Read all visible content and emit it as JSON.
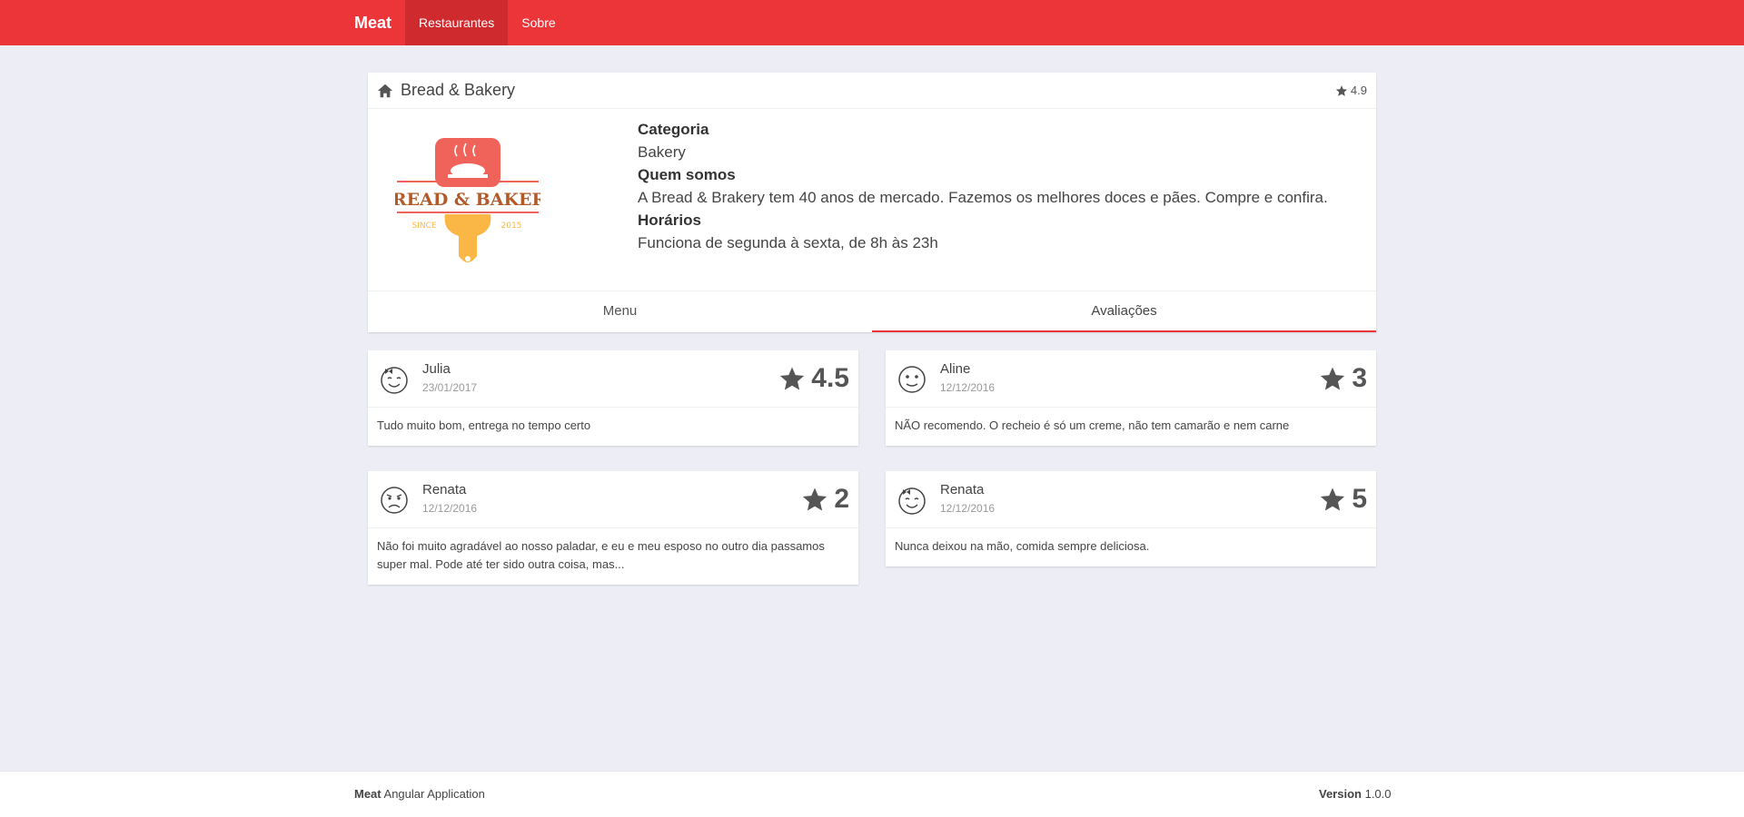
{
  "navbar": {
    "brand": "Meat",
    "links": [
      {
        "label": "Restaurantes",
        "active": true
      },
      {
        "label": "Sobre",
        "active": false
      }
    ],
    "color": "#ec3539"
  },
  "restaurant": {
    "name": "Bread & Bakery",
    "rating": "4.9",
    "logo": {
      "text": "BREAD & BAKERY",
      "since": "SINCE",
      "year": "2015"
    },
    "category_label": "Categoria",
    "category": "Bakery",
    "about_label": "Quem somos",
    "about": "A Bread & Brakery tem 40 anos de mercado. Fazemos os melhores doces e pães. Compre e confira.",
    "hours_label": "Horários",
    "hours": "Funciona de segunda à sexta, de 8h às 23h",
    "tabs": [
      {
        "label": "Menu",
        "active": false
      },
      {
        "label": "Avaliações",
        "active": true
      }
    ]
  },
  "reviews": [
    {
      "name": "Julia",
      "date": "23/01/2017",
      "rating": "4.5",
      "comment": "Tudo muito bom, entrega no tempo certo",
      "avatar": "happy-girl-icon"
    },
    {
      "name": "Aline",
      "date": "12/12/2016",
      "rating": "3",
      "comment": "NÃO recomendo. O recheio é só um creme, não tem camarão e nem carne",
      "avatar": "neutral-face-icon"
    },
    {
      "name": "Renata",
      "date": "12/12/2016",
      "rating": "2",
      "comment": "Não foi muito agradável ao nosso paladar, e eu e meu esposo no outro dia passamos super mal. Pode até ter sido outra coisa, mas...",
      "avatar": "sad-face-icon"
    },
    {
      "name": "Renata",
      "date": "12/12/2016",
      "rating": "5",
      "comment": "Nunca deixou na mão, comida sempre deliciosa.",
      "avatar": "happy-girl-icon"
    }
  ],
  "footer": {
    "brand": "Meat",
    "tagline": "Angular Application",
    "version_label": "Version",
    "version": "1.0.0"
  }
}
